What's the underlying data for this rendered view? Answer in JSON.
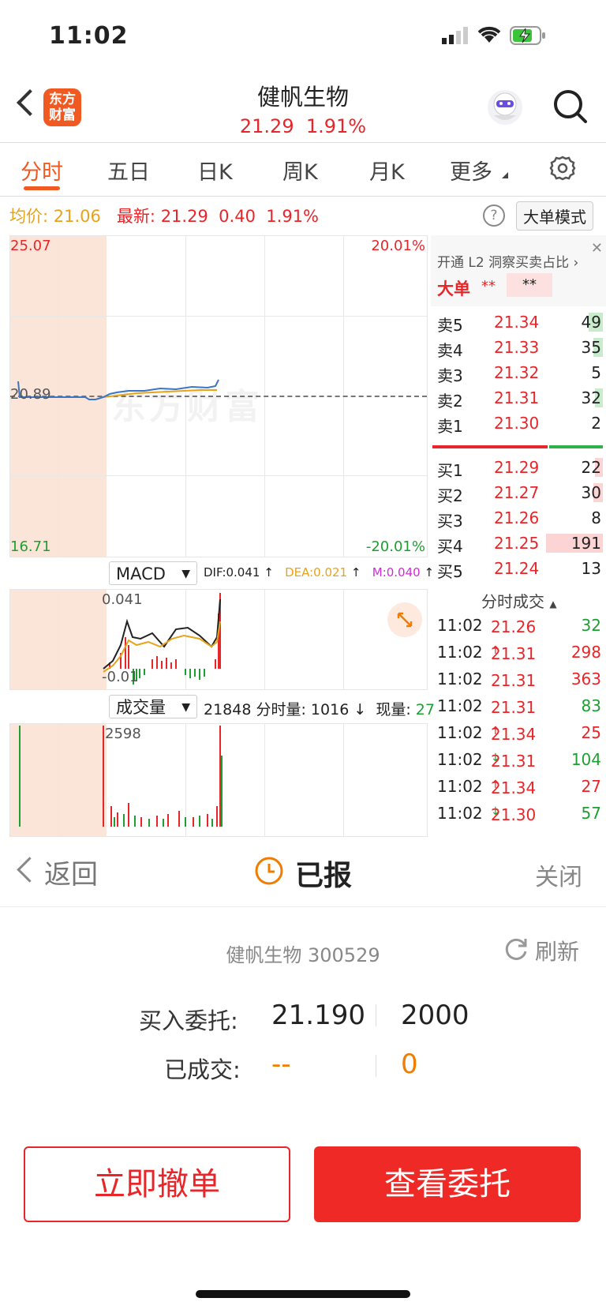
{
  "status_bar": {
    "time": "11:02"
  },
  "header": {
    "logo_text_1": "东方",
    "logo_text_2": "财富",
    "stock_name": "健帆生物",
    "price": "21.29",
    "change_pct": "1.91%"
  },
  "tabs": [
    "分时",
    "五日",
    "日K",
    "周K",
    "月K",
    "更多"
  ],
  "info_line": {
    "avg_label": "均价:",
    "avg_value": "21.06",
    "latest_label": "最新:",
    "latest_value": "21.29",
    "change": "0.40",
    "change_pct": "1.91%",
    "big_order_mode": "大单模式"
  },
  "price_chart": {
    "top_price": "25.07",
    "top_pct": "20.01%",
    "mid_price": "20.89",
    "bottom_price": "16.71",
    "bottom_pct": "-20.01%",
    "watermark": "东方财富"
  },
  "macd_bar": {
    "selector": "MACD",
    "dif": "DIF:0.041",
    "dea": "DEA:0.021",
    "m": "M:0.040",
    "top_value": "0.041",
    "bottom_value": "-0.01"
  },
  "volume_bar": {
    "selector": "成交量",
    "summary_a": "21848 分时量: 1016",
    "current_label": "现量:",
    "current_value": "27",
    "top_value": "2598"
  },
  "l2": {
    "promo": "开通 L2 洞察买卖占比",
    "big_label": "大单",
    "big_value": "**",
    "big_value2": "**"
  },
  "asks": [
    {
      "label": "卖5",
      "price": "21.34",
      "vol": "49"
    },
    {
      "label": "卖4",
      "price": "21.33",
      "vol": "35"
    },
    {
      "label": "卖3",
      "price": "21.32",
      "vol": "5"
    },
    {
      "label": "卖2",
      "price": "21.31",
      "vol": "32"
    },
    {
      "label": "卖1",
      "price": "21.30",
      "vol": "2"
    }
  ],
  "bids": [
    {
      "label": "买1",
      "price": "21.29",
      "vol": "22"
    },
    {
      "label": "买2",
      "price": "21.27",
      "vol": "30"
    },
    {
      "label": "买3",
      "price": "21.26",
      "vol": "8"
    },
    {
      "label": "买4",
      "price": "21.25",
      "vol": "191"
    },
    {
      "label": "买5",
      "price": "21.24",
      "vol": "13"
    }
  ],
  "trades_header": "分时成交",
  "trades": [
    {
      "time": "11:02",
      "price": "21.26",
      "arrow": "",
      "vol": "32",
      "color": "green"
    },
    {
      "time": "11:02",
      "price": "21.31",
      "arrow": "↑",
      "vol": "298",
      "color": "red"
    },
    {
      "time": "11:02",
      "price": "21.31",
      "arrow": "",
      "vol": "363",
      "color": "red"
    },
    {
      "time": "11:02",
      "price": "21.31",
      "arrow": "",
      "vol": "83",
      "color": "green"
    },
    {
      "time": "11:02",
      "price": "21.34",
      "arrow": "↑",
      "vol": "25",
      "color": "red"
    },
    {
      "time": "11:02",
      "price": "21.31",
      "arrow": "↓",
      "vol": "104",
      "color": "green"
    },
    {
      "time": "11:02",
      "price": "21.34",
      "arrow": "↑",
      "vol": "27",
      "color": "red"
    },
    {
      "time": "11:02",
      "price": "21.30",
      "arrow": "↓",
      "vol": "57",
      "color": "green"
    }
  ],
  "overlay": {
    "back": "返回",
    "status": "已报",
    "close": "关闭",
    "stock": "健帆生物 300529",
    "refresh": "刷新",
    "buy_label": "买入委托:",
    "buy_price": "21.190",
    "buy_qty": "2000",
    "filled_label": "已成交:",
    "filled_price": "--",
    "filled_qty": "0",
    "cancel_btn": "立即撤单",
    "view_btn": "查看委托"
  }
}
